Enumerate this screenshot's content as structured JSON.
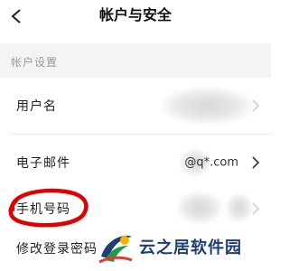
{
  "header": {
    "title": "帐户与安全",
    "back_icon": "chevron-left-icon"
  },
  "section": {
    "title": "帐户设置"
  },
  "rows": [
    {
      "label": "用户名",
      "value": ""
    },
    {
      "label": "电子邮件",
      "value": "@q*.com"
    },
    {
      "label": "手机号码",
      "value": ""
    },
    {
      "label": "修改登录密码",
      "value": ""
    }
  ],
  "watermark": {
    "text": "云之居软件园"
  },
  "colors": {
    "annotation_red": "#e00000",
    "section_bg": "#f4f4f4",
    "watermark_blue": "#1d3f76"
  }
}
